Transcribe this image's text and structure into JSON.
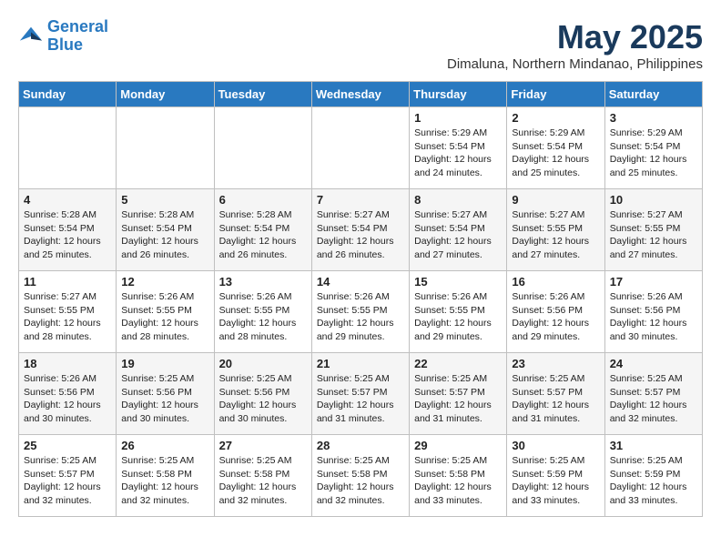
{
  "header": {
    "logo_line1": "General",
    "logo_line2": "Blue",
    "month": "May 2025",
    "location": "Dimaluna, Northern Mindanao, Philippines"
  },
  "days_of_week": [
    "Sunday",
    "Monday",
    "Tuesday",
    "Wednesday",
    "Thursday",
    "Friday",
    "Saturday"
  ],
  "weeks": [
    [
      {
        "day": "",
        "info": ""
      },
      {
        "day": "",
        "info": ""
      },
      {
        "day": "",
        "info": ""
      },
      {
        "day": "",
        "info": ""
      },
      {
        "day": "1",
        "info": "Sunrise: 5:29 AM\nSunset: 5:54 PM\nDaylight: 12 hours\nand 24 minutes."
      },
      {
        "day": "2",
        "info": "Sunrise: 5:29 AM\nSunset: 5:54 PM\nDaylight: 12 hours\nand 25 minutes."
      },
      {
        "day": "3",
        "info": "Sunrise: 5:29 AM\nSunset: 5:54 PM\nDaylight: 12 hours\nand 25 minutes."
      }
    ],
    [
      {
        "day": "4",
        "info": "Sunrise: 5:28 AM\nSunset: 5:54 PM\nDaylight: 12 hours\nand 25 minutes."
      },
      {
        "day": "5",
        "info": "Sunrise: 5:28 AM\nSunset: 5:54 PM\nDaylight: 12 hours\nand 26 minutes."
      },
      {
        "day": "6",
        "info": "Sunrise: 5:28 AM\nSunset: 5:54 PM\nDaylight: 12 hours\nand 26 minutes."
      },
      {
        "day": "7",
        "info": "Sunrise: 5:27 AM\nSunset: 5:54 PM\nDaylight: 12 hours\nand 26 minutes."
      },
      {
        "day": "8",
        "info": "Sunrise: 5:27 AM\nSunset: 5:54 PM\nDaylight: 12 hours\nand 27 minutes."
      },
      {
        "day": "9",
        "info": "Sunrise: 5:27 AM\nSunset: 5:55 PM\nDaylight: 12 hours\nand 27 minutes."
      },
      {
        "day": "10",
        "info": "Sunrise: 5:27 AM\nSunset: 5:55 PM\nDaylight: 12 hours\nand 27 minutes."
      }
    ],
    [
      {
        "day": "11",
        "info": "Sunrise: 5:27 AM\nSunset: 5:55 PM\nDaylight: 12 hours\nand 28 minutes."
      },
      {
        "day": "12",
        "info": "Sunrise: 5:26 AM\nSunset: 5:55 PM\nDaylight: 12 hours\nand 28 minutes."
      },
      {
        "day": "13",
        "info": "Sunrise: 5:26 AM\nSunset: 5:55 PM\nDaylight: 12 hours\nand 28 minutes."
      },
      {
        "day": "14",
        "info": "Sunrise: 5:26 AM\nSunset: 5:55 PM\nDaylight: 12 hours\nand 29 minutes."
      },
      {
        "day": "15",
        "info": "Sunrise: 5:26 AM\nSunset: 5:55 PM\nDaylight: 12 hours\nand 29 minutes."
      },
      {
        "day": "16",
        "info": "Sunrise: 5:26 AM\nSunset: 5:56 PM\nDaylight: 12 hours\nand 29 minutes."
      },
      {
        "day": "17",
        "info": "Sunrise: 5:26 AM\nSunset: 5:56 PM\nDaylight: 12 hours\nand 30 minutes."
      }
    ],
    [
      {
        "day": "18",
        "info": "Sunrise: 5:26 AM\nSunset: 5:56 PM\nDaylight: 12 hours\nand 30 minutes."
      },
      {
        "day": "19",
        "info": "Sunrise: 5:25 AM\nSunset: 5:56 PM\nDaylight: 12 hours\nand 30 minutes."
      },
      {
        "day": "20",
        "info": "Sunrise: 5:25 AM\nSunset: 5:56 PM\nDaylight: 12 hours\nand 30 minutes."
      },
      {
        "day": "21",
        "info": "Sunrise: 5:25 AM\nSunset: 5:57 PM\nDaylight: 12 hours\nand 31 minutes."
      },
      {
        "day": "22",
        "info": "Sunrise: 5:25 AM\nSunset: 5:57 PM\nDaylight: 12 hours\nand 31 minutes."
      },
      {
        "day": "23",
        "info": "Sunrise: 5:25 AM\nSunset: 5:57 PM\nDaylight: 12 hours\nand 31 minutes."
      },
      {
        "day": "24",
        "info": "Sunrise: 5:25 AM\nSunset: 5:57 PM\nDaylight: 12 hours\nand 32 minutes."
      }
    ],
    [
      {
        "day": "25",
        "info": "Sunrise: 5:25 AM\nSunset: 5:57 PM\nDaylight: 12 hours\nand 32 minutes."
      },
      {
        "day": "26",
        "info": "Sunrise: 5:25 AM\nSunset: 5:58 PM\nDaylight: 12 hours\nand 32 minutes."
      },
      {
        "day": "27",
        "info": "Sunrise: 5:25 AM\nSunset: 5:58 PM\nDaylight: 12 hours\nand 32 minutes."
      },
      {
        "day": "28",
        "info": "Sunrise: 5:25 AM\nSunset: 5:58 PM\nDaylight: 12 hours\nand 32 minutes."
      },
      {
        "day": "29",
        "info": "Sunrise: 5:25 AM\nSunset: 5:58 PM\nDaylight: 12 hours\nand 33 minutes."
      },
      {
        "day": "30",
        "info": "Sunrise: 5:25 AM\nSunset: 5:59 PM\nDaylight: 12 hours\nand 33 minutes."
      },
      {
        "day": "31",
        "info": "Sunrise: 5:25 AM\nSunset: 5:59 PM\nDaylight: 12 hours\nand 33 minutes."
      }
    ]
  ]
}
